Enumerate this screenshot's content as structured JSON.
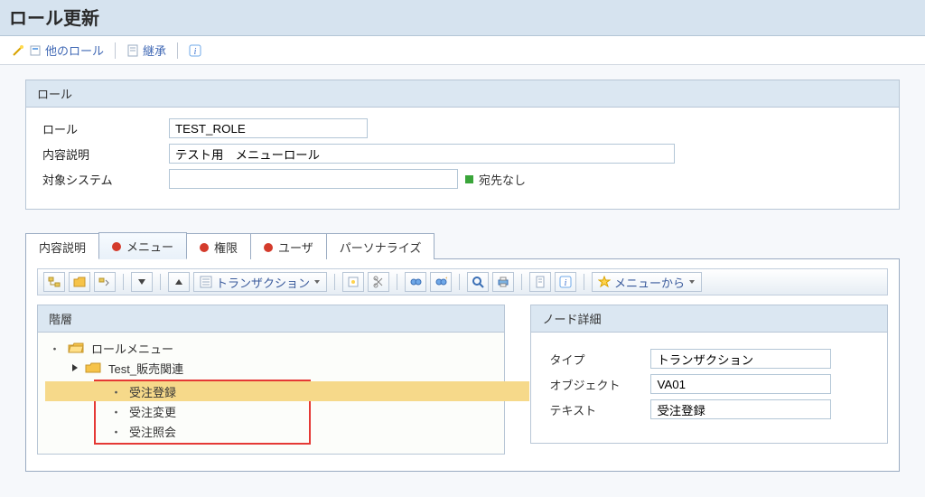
{
  "header": {
    "title": "ロール更新"
  },
  "top_toolbar": {
    "other_role_label": "他のロール",
    "inherit_label": "継承"
  },
  "role_group": {
    "title": "ロール",
    "labels": {
      "role": "ロール",
      "desc": "内容説明",
      "system": "対象システム"
    },
    "values": {
      "role": "TEST_ROLE",
      "desc": "テスト用　メニューロール",
      "system": ""
    },
    "after_system": "宛先なし"
  },
  "tabs": {
    "desc": "内容説明",
    "menu": "メニュー",
    "auth": "権限",
    "user": "ユーザ",
    "personalize": "パーソナライズ"
  },
  "inner_toolbar": {
    "transaction": "トランザクション",
    "menu_from": "メニューから"
  },
  "hierarchy": {
    "title": "階層",
    "root": "ロールメニュー",
    "sub": "Test_販売関連",
    "items": [
      "受注登録",
      "受注変更",
      "受注照会"
    ]
  },
  "node_detail": {
    "title": "ノード詳細",
    "labels": {
      "type": "タイプ",
      "object": "オブジェクト",
      "text": "テキスト"
    },
    "values": {
      "type": "トランザクション",
      "object": "VA01",
      "text": "受注登録"
    }
  }
}
